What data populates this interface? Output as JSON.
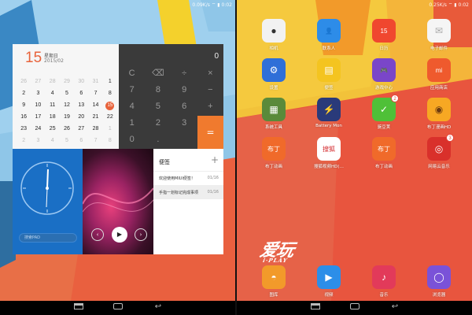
{
  "status_bar": {
    "left_screen": "0.09K/s ⌔ ▮ 0:02",
    "right_screen": "0.25K/s ⌔ ▮ 0:02"
  },
  "calendar": {
    "day": "15",
    "weekday": "星期日",
    "year_month": "2015/02",
    "rows": [
      [
        {
          "v": "26",
          "dim": true
        },
        {
          "v": "27",
          "dim": true
        },
        {
          "v": "28",
          "dim": true
        },
        {
          "v": "29",
          "dim": true
        },
        {
          "v": "30",
          "dim": true
        },
        {
          "v": "31",
          "dim": true
        },
        {
          "v": "1"
        }
      ],
      [
        {
          "v": "2"
        },
        {
          "v": "3"
        },
        {
          "v": "4"
        },
        {
          "v": "5"
        },
        {
          "v": "6"
        },
        {
          "v": "7"
        },
        {
          "v": "8"
        }
      ],
      [
        {
          "v": "9"
        },
        {
          "v": "10"
        },
        {
          "v": "11"
        },
        {
          "v": "12"
        },
        {
          "v": "13"
        },
        {
          "v": "14"
        },
        {
          "v": "15",
          "today": true
        }
      ],
      [
        {
          "v": "16"
        },
        {
          "v": "17"
        },
        {
          "v": "18"
        },
        {
          "v": "19"
        },
        {
          "v": "20"
        },
        {
          "v": "21"
        },
        {
          "v": "22"
        }
      ],
      [
        {
          "v": "23"
        },
        {
          "v": "24"
        },
        {
          "v": "25"
        },
        {
          "v": "26"
        },
        {
          "v": "27"
        },
        {
          "v": "28"
        },
        {
          "v": "1",
          "dim": true
        }
      ],
      [
        {
          "v": "2",
          "dim": true
        },
        {
          "v": "3",
          "dim": true
        },
        {
          "v": "4",
          "dim": true
        },
        {
          "v": "5",
          "dim": true
        },
        {
          "v": "6",
          "dim": true
        },
        {
          "v": "7",
          "dim": true
        },
        {
          "v": "8",
          "dim": true
        }
      ]
    ]
  },
  "calculator": {
    "display": "0",
    "keys": [
      [
        "C",
        "⌫",
        "÷",
        "×"
      ],
      [
        "7",
        "8",
        "9",
        "−"
      ],
      [
        "4",
        "5",
        "6",
        "+"
      ],
      [
        "1",
        "2",
        "3",
        ""
      ],
      [
        "0",
        ".",
        "",
        ""
      ]
    ],
    "equals": "="
  },
  "clock_widget": {
    "search_placeholder": "搜索PAD"
  },
  "music_widget": {
    "prev": "‹",
    "play": "▶",
    "next": "›"
  },
  "notes_widget": {
    "title": "便签",
    "add": "+",
    "items": [
      {
        "text": "欢迎使用MIUI便签！",
        "date": "01/16"
      },
      {
        "text": "手指一划标记完成事项",
        "date": "01/16"
      }
    ]
  },
  "apps": [
    {
      "label": "相机",
      "icon": "camera-icon",
      "glyph": "●",
      "color": "#f2f2f2",
      "fg": "#333"
    },
    {
      "label": "联系人",
      "icon": "contacts-icon",
      "glyph": "👤",
      "color": "#2d8ce8",
      "fg": "#fff"
    },
    {
      "label": "日历",
      "icon": "calendar-app-icon",
      "glyph": "15",
      "color": "#f0472f",
      "fg": "#fff"
    },
    {
      "label": "电子邮件",
      "icon": "mail-icon",
      "glyph": "✉",
      "color": "#f5f5f5",
      "fg": "#aaa"
    },
    {
      "label": "设置",
      "icon": "settings-icon",
      "glyph": "⚙",
      "color": "#2f6fd8",
      "fg": "#fff"
    },
    {
      "label": "便签",
      "icon": "notes-app-icon",
      "glyph": "▤",
      "color": "#f4c420",
      "fg": "#fff"
    },
    {
      "label": "游戏中心",
      "icon": "game-center-icon",
      "glyph": "🎮",
      "color": "#7a46c9",
      "fg": "#fff"
    },
    {
      "label": "应用商店",
      "icon": "app-store-icon",
      "glyph": "mi",
      "color": "#ef5a2d",
      "fg": "#fff"
    },
    {
      "label": "系统工具",
      "icon": "system-tools-folder-icon",
      "glyph": "▦",
      "color": "#5a8a3a",
      "fg": "#fff"
    },
    {
      "label": "Battery Mon",
      "icon": "battery-monitor-icon",
      "glyph": "⚡",
      "color": "#2a3a7a",
      "fg": "#f4c430"
    },
    {
      "label": "豌豆荚",
      "icon": "wandoujia-icon",
      "glyph": "✓",
      "color": "#4fc038",
      "fg": "#fff",
      "badge": "2"
    },
    {
      "label": "布丁漫画HD",
      "icon": "pudding-comics-icon",
      "glyph": "◉",
      "color": "#f7a823",
      "fg": "#6a3a10"
    },
    {
      "label": "布丁动画",
      "icon": "pudding-anime-icon",
      "glyph": "布丁",
      "color": "#f06a2a",
      "fg": "#fff"
    },
    {
      "label": "搜狐视频HD(…",
      "icon": "sohu-video-icon",
      "glyph": "搜狐",
      "color": "#ffffff",
      "fg": "#d3262a"
    },
    {
      "label": "布丁动画",
      "icon": "pudding-anime-2-icon",
      "glyph": "布丁",
      "color": "#f06a2a",
      "fg": "#fff"
    },
    {
      "label": "网易云音乐",
      "icon": "netease-music-icon",
      "glyph": "◎",
      "color": "#d9302b",
      "fg": "#fff",
      "badge": "3"
    }
  ],
  "dock": [
    {
      "label": "图库",
      "icon": "gallery-icon",
      "glyph": "◓",
      "color": "#f29a2a",
      "fg": "#fff"
    },
    {
      "label": "视频",
      "icon": "video-icon",
      "glyph": "▶",
      "color": "#2c8ee8",
      "fg": "#fff"
    },
    {
      "label": "音乐",
      "icon": "music-icon",
      "glyph": "♪",
      "color": "#e23a5a",
      "fg": "#fff"
    },
    {
      "label": "浏览器",
      "icon": "browser-icon",
      "glyph": "◯",
      "color": "#7a52d8",
      "fg": "#fff"
    }
  ],
  "watermark": {
    "main": "爱玩",
    "sub": "i·PLAY"
  }
}
